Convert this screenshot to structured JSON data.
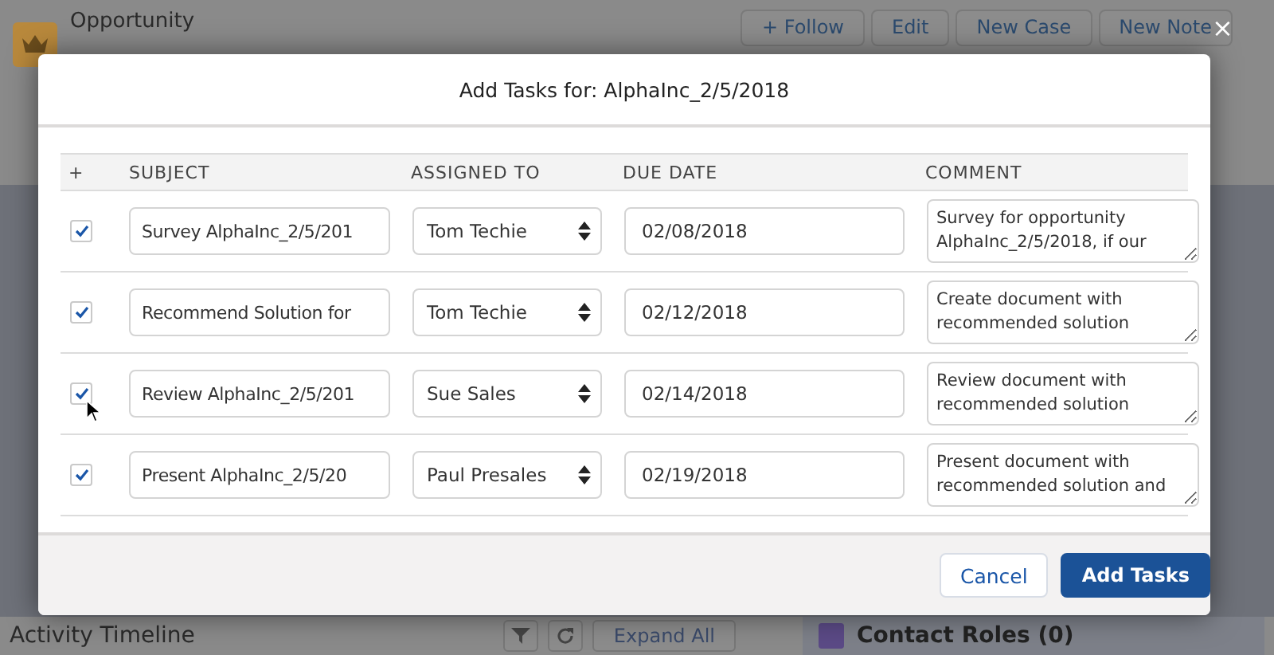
{
  "background": {
    "record_type": "Opportunity",
    "actions": [
      "+ Follow",
      "Edit",
      "New Case",
      "New Note"
    ],
    "timeline_title": "Activity Timeline",
    "expand_button": "Expand All",
    "related_title": "Contact Roles (0)"
  },
  "dialog": {
    "close": "×",
    "title": "Add Tasks for: AlphaInc_2/5/2018",
    "columns": [
      "+",
      "SUBJECT",
      "ASSIGNED TO",
      "DUE DATE",
      "COMMENT"
    ],
    "rows": [
      {
        "checked": true,
        "subject": "Survey AlphaInc_2/5/201",
        "assigned_to": "Tom Techie",
        "due_date": "02/08/2018",
        "comment": "Survey for opportunity AlphaInc_2/5/2018, if our"
      },
      {
        "checked": true,
        "subject": "Recommend Solution for",
        "assigned_to": "Tom Techie",
        "due_date": "02/12/2018",
        "comment": "Create document with recommended solution"
      },
      {
        "checked": true,
        "subject": "Review AlphaInc_2/5/201",
        "assigned_to": "Sue Sales",
        "due_date": "02/14/2018",
        "comment": "Review document with recommended solution"
      },
      {
        "checked": true,
        "subject": "Present AlphaInc_2/5/20",
        "assigned_to": "Paul Presales",
        "due_date": "02/19/2018",
        "comment": "Present document with recommended solution and"
      }
    ],
    "buttons": [
      {
        "label": "Cancel",
        "kind": "neutral"
      },
      {
        "label": "Add Tasks",
        "kind": "brand"
      }
    ]
  }
}
